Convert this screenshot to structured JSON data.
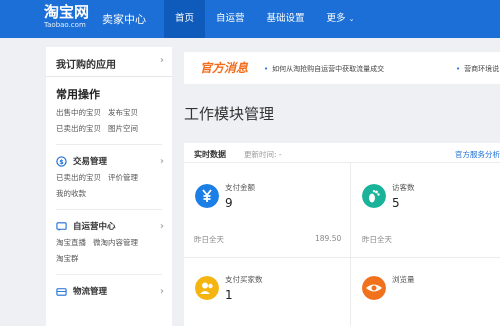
{
  "header": {
    "brand": "淘宝网",
    "domain": "Taobao.com",
    "seller_center": "卖家中心",
    "nav": [
      "首页",
      "自运营",
      "基础设置",
      "更多"
    ],
    "more_chevron": "⌄"
  },
  "sidebar": {
    "my_apps": "我订购的应用",
    "arrow": "›",
    "common_title": "常用操作",
    "common_links_1": [
      "出售中的宝贝",
      "发布宝贝"
    ],
    "common_links_2": [
      "已卖出的宝贝",
      "图片空间"
    ],
    "groups": [
      {
        "title": "交易管理",
        "icon": "trade-icon",
        "links": [
          "已卖出的宝贝",
          "评价管理",
          "我的收款"
        ]
      },
      {
        "title": "自运营中心",
        "icon": "chat-icon",
        "links": [
          "淘宝直播",
          "微淘内容管理",
          "淘宝群"
        ]
      },
      {
        "title": "物流管理",
        "icon": "logistics-icon",
        "links": []
      }
    ]
  },
  "notice": {
    "title": "官方消息",
    "items": [
      "如何从淘抢购自运营中获取流量成交",
      "营商环境说"
    ]
  },
  "module": {
    "title": "工作模块管理"
  },
  "panel": {
    "realtime": "实时数据",
    "updated": "更新时间: -",
    "service_link": "官方服务分析",
    "cards": [
      {
        "label": "支付金额",
        "value": "9",
        "foot": "昨日全天",
        "foot_val": "189.50",
        "icon": "yen-icon",
        "color": "#1b7fe5"
      },
      {
        "label": "访客数",
        "value": "5",
        "foot": "昨日全天",
        "foot_val": "",
        "icon": "footprint-icon",
        "color": "#19b39a"
      },
      {
        "label": "支付买家数",
        "value": "1",
        "foot": "",
        "foot_val": "",
        "icon": "buyer-icon",
        "color": "#f5b511"
      },
      {
        "label": "浏览量",
        "value": "",
        "foot": "",
        "foot_val": "",
        "icon": "eye-icon",
        "color": "#f2711c"
      }
    ]
  }
}
